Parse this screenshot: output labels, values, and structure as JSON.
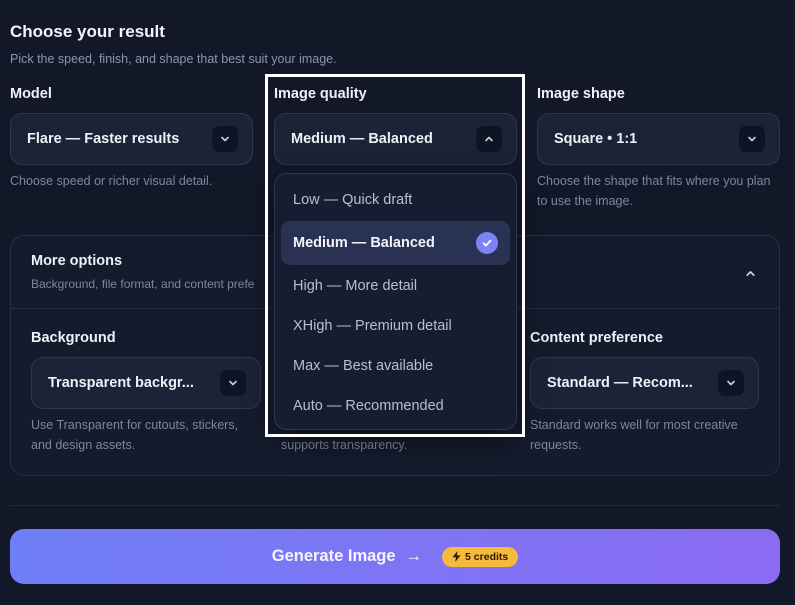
{
  "header": {
    "title": "Choose your result",
    "subtitle": "Pick the speed, finish, and shape that best suit your image."
  },
  "model": {
    "label": "Model",
    "value": "Flare — Faster results",
    "help": "Choose speed or richer visual detail."
  },
  "quality": {
    "label": "Image quality",
    "value": "Medium — Balanced",
    "help_fragment": "supports transparency.",
    "options": [
      "Low — Quick draft",
      "Medium — Balanced",
      "High — More detail",
      "XHigh — Premium detail",
      "Max — Best available",
      "Auto — Recommended"
    ],
    "selected_index": 1
  },
  "shape": {
    "label": "Image shape",
    "value": "Square • 1:1",
    "help_line1": "Choose the shape that fits where you plan",
    "help_line2": "to use the image."
  },
  "more_options": {
    "title": "More options",
    "subtitle": "Background, file format, and content prefe",
    "background": {
      "label": "Background",
      "value": "Transparent backgr...",
      "help_line1": "Use Transparent for cutouts, stickers,",
      "help_line2": "and design assets."
    },
    "content": {
      "label": "Content preference",
      "value": "Standard — Recom...",
      "help_line1": "Standard works well for most creative",
      "help_line2": "requests."
    }
  },
  "generate": {
    "label": "Generate Image",
    "arrow": "→",
    "credits": "5 credits"
  },
  "colors": {
    "background": "#121828",
    "accent_start": "#6f7ff6",
    "accent_end": "#8b6bf2",
    "credits_badge": "#f5b93c",
    "check": "#7c84f5"
  }
}
